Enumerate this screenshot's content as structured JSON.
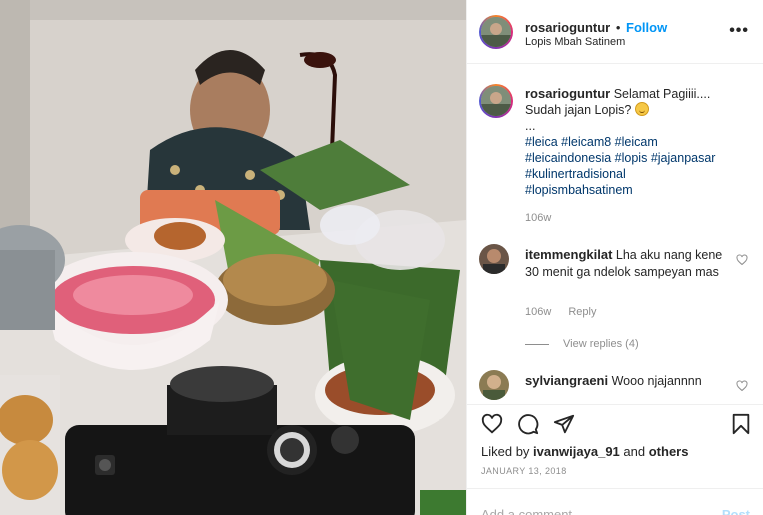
{
  "post": {
    "username": "rosarioguntur",
    "follow_label": "Follow",
    "dot": "•",
    "location": "Lopis Mbah Satinem",
    "more_label": "•••"
  },
  "caption": {
    "username": "rosarioguntur",
    "line1": "Selamat Pagiiii....",
    "line2": "Sudah jajan Lopis?",
    "line3": "...",
    "hashtags": [
      "#leica",
      "#leicam8",
      "#leicam",
      "#leicaindonesia",
      "#lopis",
      "#jajanpasar",
      "#kulinertradisional",
      "#lopismbahsatinem"
    ],
    "time": "106w"
  },
  "comments": [
    {
      "username": "itemmengkilat",
      "text": "Lha aku nang kene 30 menit ga ndelok sampeyan mas",
      "time": "106w",
      "reply_label": "Reply",
      "view_replies": "View replies (4)"
    },
    {
      "username": "sylviangraeni",
      "text": "Wooo njajannnn"
    }
  ],
  "likes": {
    "prefix": "Liked by",
    "user": "ivanwijaya_91",
    "and": "and",
    "others": "others"
  },
  "date": "JANUARY 13, 2018",
  "add_comment": {
    "placeholder": "Add a comment...",
    "post_label": "Post"
  },
  "icons": [
    "more-icon",
    "heart-icon",
    "comment-icon",
    "share-icon",
    "bookmark-icon"
  ],
  "colors": {
    "accent": "#0095f6",
    "link": "#00376b",
    "muted": "#8e8e8e"
  }
}
